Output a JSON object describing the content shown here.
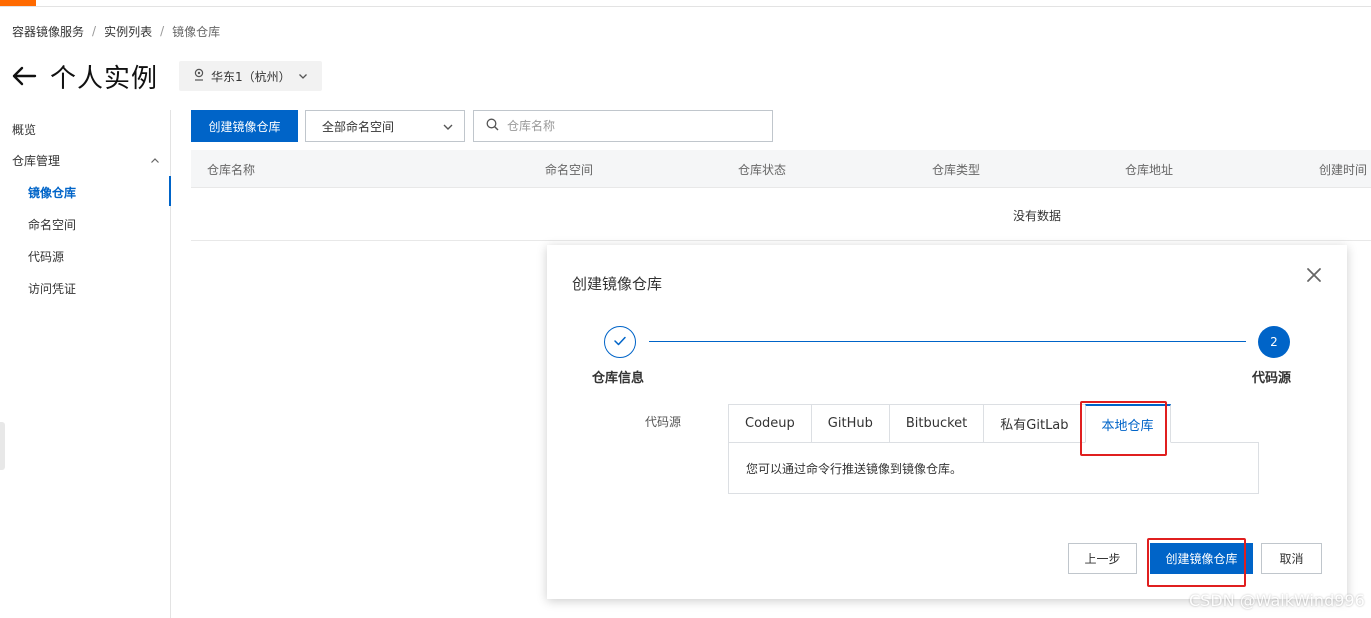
{
  "colors": {
    "primary": "#0064c8",
    "accent_orange": "#ff6a00",
    "highlight_red": "#e01f1f"
  },
  "breadcrumb": {
    "items": [
      "容器镜像服务",
      "实例列表",
      "镜像仓库"
    ],
    "separator": "/"
  },
  "page": {
    "title": "个人实例",
    "back_icon": "arrow-left-icon"
  },
  "region": {
    "value": "华东1（杭州）",
    "icon": "location-pin-icon"
  },
  "sidebar": {
    "items": [
      {
        "label": "概览"
      },
      {
        "label": "仓库管理"
      },
      {
        "label": "镜像仓库"
      },
      {
        "label": "命名空间"
      },
      {
        "label": "代码源"
      },
      {
        "label": "访问凭证"
      }
    ],
    "active": "镜像仓库"
  },
  "toolbar": {
    "create_label": "创建镜像仓库",
    "namespace_select": "全部命名空间",
    "search_placeholder": "仓库名称"
  },
  "table": {
    "columns": [
      "仓库名称",
      "命名空间",
      "仓库状态",
      "仓库类型",
      "仓库地址",
      "创建时间"
    ],
    "empty_text": "没有数据"
  },
  "modal": {
    "title": "创建镜像仓库",
    "steps": [
      {
        "label": "仓库信息",
        "status": "done"
      },
      {
        "label": "代码源",
        "number": "2",
        "status": "current"
      }
    ],
    "source_label": "代码源",
    "tabs": [
      "Codeup",
      "GitHub",
      "Bitbucket",
      "私有GitLab",
      "本地仓库"
    ],
    "active_tab": "本地仓库",
    "panel_text": "您可以通过命令行推送镜像到镜像仓库。",
    "prev_label": "上一步",
    "create_label": "创建镜像仓库",
    "cancel_label": "取消"
  },
  "watermark": "CSDN @WalkWind996"
}
